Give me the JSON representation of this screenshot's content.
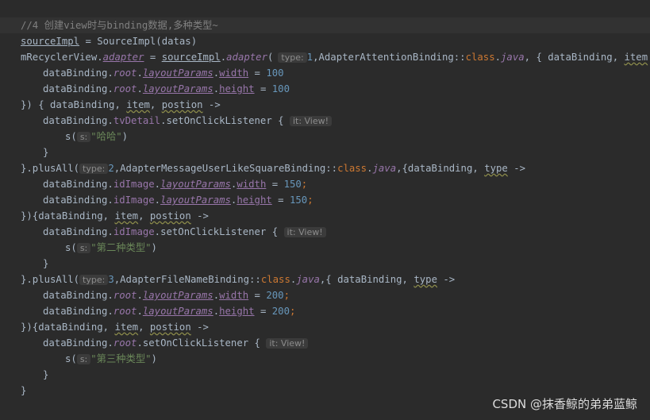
{
  "editor": {
    "lines": {
      "l1_comment": "//4 创建view时与binding数据,多种类型~",
      "l2_var": "sourceImpl",
      "l2_rest": " = SourceImpl(datas)",
      "l3_a": "mRecyclerView.",
      "l3_adapter": "adapter",
      "l3_eq": " = ",
      "l3_src": "sourceImpl",
      "l3_dot": ".",
      "l3_adapter2": "adapter",
      "l3_paren": "(",
      "l3_hint": "type:",
      "l3_num": "1",
      "l3_cls": ",AdapterAttentionBinding::",
      "l3_class_kw": "class",
      "l3_dot2": ".",
      "l3_java": "java",
      "l3_rest1": ", { dataBinding, ",
      "l3_item": "item",
      "l3_arrow": " ->",
      "l4_a": "dataBinding.",
      "l4_root": "root",
      "l4_dot": ".",
      "l4_lp": "layoutParams",
      "l4_dot2": ".",
      "l4_width": "width",
      "l4_eq": " = ",
      "l4_val": "100",
      "l5_a": "dataBinding.",
      "l5_root": "root",
      "l5_dot": ".",
      "l5_lp": "layoutParams",
      "l5_dot2": ".",
      "l5_height": "height",
      "l5_eq": " = ",
      "l5_val": "100",
      "l6_a": "}) { dataBinding, ",
      "l6_item": "item",
      "l6_c": ", ",
      "l6_postion": "postion",
      "l6_arrow": " ->",
      "l7_a": "dataBinding.",
      "l7_tv": "tvDetail",
      "l7_b": ".setOnClickListener { ",
      "l7_hint": "it: View!",
      "l8_a": "s(",
      "l8_hint": "s:",
      "l8_str": "\"哈哈\"",
      "l8_b": ")",
      "l9": "}",
      "l10_a": "}.plusAll(",
      "l10_hint": "type:",
      "l10_num": "2",
      "l10_cls": ",AdapterMessageUserLikeSquareBinding::",
      "l10_class_kw": "class",
      "l10_dot": ".",
      "l10_java": "java",
      "l10_b": ",{dataBinding, ",
      "l10_type": "type",
      "l10_arrow": " ->",
      "l11_a": "dataBinding.",
      "l11_id": "idImage",
      "l11_dot": ".",
      "l11_lp": "layoutParams",
      "l11_dot2": ".",
      "l11_width": "width",
      "l11_eq": " = ",
      "l11_val": "150",
      "l11_semi": ";",
      "l12_a": "dataBinding.",
      "l12_id": "idImage",
      "l12_dot": ".",
      "l12_lp": "layoutParams",
      "l12_dot2": ".",
      "l12_height": "height",
      "l12_eq": " = ",
      "l12_val": "150",
      "l12_semi": ";",
      "l13_a": "}){dataBinding, ",
      "l13_item": "item",
      "l13_c": ", ",
      "l13_postion": "postion",
      "l13_arrow": " ->",
      "l14_a": "dataBinding.",
      "l14_id": "idImage",
      "l14_b": ".setOnClickListener { ",
      "l14_hint": "it: View!",
      "l15_a": "s(",
      "l15_hint": "s:",
      "l15_str": "\"第二种类型\"",
      "l15_b": ")",
      "l16": "}",
      "l17_a": "}.plusAll(",
      "l17_hint": "type:",
      "l17_num": "3",
      "l17_cls": ",AdapterFileNameBinding::",
      "l17_class_kw": "class",
      "l17_dot": ".",
      "l17_java": "java",
      "l17_b": ",{ dataBinding, ",
      "l17_type": "type",
      "l17_arrow": " ->",
      "l18_a": "dataBinding.",
      "l18_root": "root",
      "l18_dot": ".",
      "l18_lp": "layoutParams",
      "l18_dot2": ".",
      "l18_width": "width",
      "l18_eq": " = ",
      "l18_val": "200",
      "l18_semi": ";",
      "l19_a": "dataBinding.",
      "l19_root": "root",
      "l19_dot": ".",
      "l19_lp": "layoutParams",
      "l19_dot2": ".",
      "l19_height": "height",
      "l19_eq": " = ",
      "l19_val": "200",
      "l19_semi": ";",
      "l20_a": "}){dataBinding, ",
      "l20_item": "item",
      "l20_c": ", ",
      "l20_postion": "postion",
      "l20_arrow": " ->",
      "l21_a": "dataBinding.",
      "l21_root": "root",
      "l21_b": ".setOnClickListener { ",
      "l21_hint": "it: View!",
      "l22_a": "s(",
      "l22_hint": "s:",
      "l22_str": "\"第三种类型\"",
      "l22_b": ")",
      "l23": "}",
      "l24": "}"
    }
  },
  "watermark": "CSDN @抹香鲸的弟弟蓝鲸",
  "colors": {
    "background": "#2b2b2b",
    "keyword": "#cc7832",
    "number": "#6897bb",
    "string": "#6a8759",
    "property": "#9876aa",
    "comment": "#808080",
    "text": "#a9b7c6"
  }
}
